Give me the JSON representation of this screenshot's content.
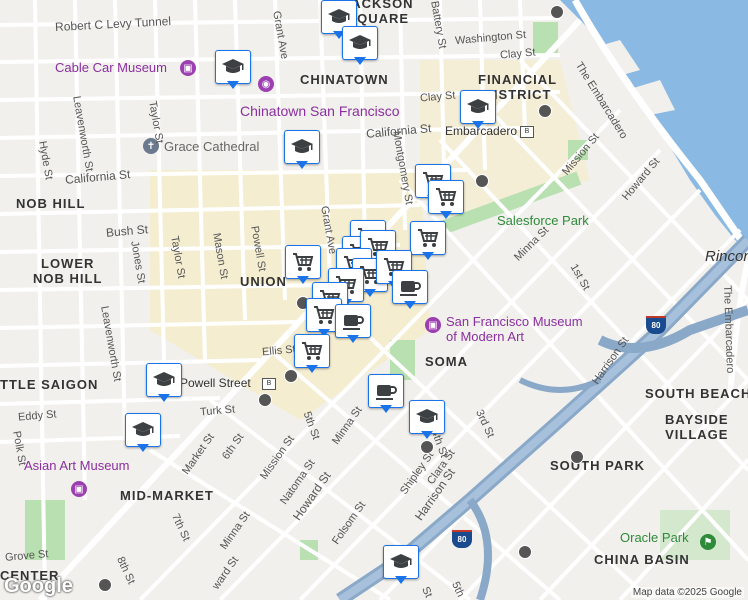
{
  "neighborhoods": [
    {
      "id": "jackson-square",
      "text": "JACKSON\nSQUARE"
    },
    {
      "id": "chinatown",
      "text": "CHINATOWN"
    },
    {
      "id": "financial-district",
      "text": "FINANCIAL\nDISTRICT"
    },
    {
      "id": "nob-hill",
      "text": "NOB HILL"
    },
    {
      "id": "lower-nob-hill",
      "text": "LOWER\nNOB HILL"
    },
    {
      "id": "union-square",
      "text": "UNION"
    },
    {
      "id": "soma",
      "text": "SOMA"
    },
    {
      "id": "south-beach",
      "text": "SOUTH BEACH"
    },
    {
      "id": "bayside-village",
      "text": "BAYSIDE\nVILLAGE"
    },
    {
      "id": "south-park",
      "text": "SOUTH PARK"
    },
    {
      "id": "mid-market",
      "text": "MID-MARKET"
    },
    {
      "id": "china-basin",
      "text": "CHINA BASIN"
    },
    {
      "id": "little-saigon",
      "text": "TTLE SAIGON"
    },
    {
      "id": "rincon",
      "text": "Rincon"
    },
    {
      "id": "center",
      "text": "CENTER"
    }
  ],
  "pois": [
    {
      "id": "cable-car-museum",
      "text": "Cable Car Museum"
    },
    {
      "id": "chinatown-sf",
      "text": "Chinatown San Francisco"
    },
    {
      "id": "grace-cathedral",
      "text": "Grace Cathedral"
    },
    {
      "id": "sfmoma",
      "text": "San Francisco Museum\nof Modern Art"
    },
    {
      "id": "asian-art-museum",
      "text": "Asian Art Museum"
    },
    {
      "id": "salesforce-park",
      "text": "Salesforce Park"
    },
    {
      "id": "oracle-park",
      "text": "Oracle Park"
    },
    {
      "id": "embarcadero-station",
      "text": "Embarcadero"
    },
    {
      "id": "powell-station",
      "text": "Powell Street"
    }
  ],
  "streets": [
    "Robert C Levy Tunnel",
    "Grant Ave",
    "Battery St",
    "Washington St",
    "Clay St",
    "Clay St",
    "Taylor St",
    "Leavenworth St",
    "Hyde St",
    "California St",
    "California St",
    "Montgomery St",
    "Mission St",
    "Howard St",
    "The Embarcadero",
    "The Embarcadero",
    "Bush St",
    "Jones St",
    "Taylor St",
    "Mason St",
    "Powell St",
    "Grant Ave",
    "Minna St",
    "1st St",
    "Harrison St",
    "Ellis St",
    "Eddy St",
    "Turk St",
    "Market St",
    "6th St",
    "Mission St",
    "5th St",
    "Natoma St",
    "Howard St",
    "Minna St",
    "3rd St",
    "4th St",
    "Clara St",
    "Shipley St",
    "Harrison St",
    "Folsom St",
    "7th St",
    "Minna St",
    "8th St",
    "Grove St",
    "Polk St",
    "Leavenworth St",
    "ward St",
    "5th",
    "St"
  ],
  "markers": [
    {
      "type": "school"
    },
    {
      "type": "school"
    },
    {
      "type": "school"
    },
    {
      "type": "school"
    },
    {
      "type": "school"
    },
    {
      "type": "school"
    },
    {
      "type": "school"
    },
    {
      "type": "school"
    },
    {
      "type": "school"
    },
    {
      "type": "grocery"
    },
    {
      "type": "grocery"
    },
    {
      "type": "grocery"
    },
    {
      "type": "grocery"
    },
    {
      "type": "grocery"
    },
    {
      "type": "grocery"
    },
    {
      "type": "grocery"
    },
    {
      "type": "grocery"
    },
    {
      "type": "grocery"
    },
    {
      "type": "grocery"
    },
    {
      "type": "grocery"
    },
    {
      "type": "grocery"
    },
    {
      "type": "grocery"
    },
    {
      "type": "grocery"
    },
    {
      "type": "cafe"
    },
    {
      "type": "cafe"
    },
    {
      "type": "cafe"
    }
  ],
  "attribution": "Map data ©2025 Google",
  "logo": "Google",
  "highway": "80",
  "colors": {
    "marker_border": "#1a73e8",
    "poi": "#8b2fa0",
    "water": "#6fa7d6",
    "park": "#b8e0b0"
  }
}
